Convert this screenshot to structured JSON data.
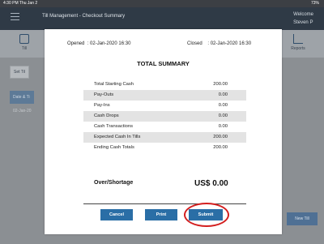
{
  "status_bar": {
    "time": "4:30 PM   Thu Jan 2",
    "battery": "73%"
  },
  "app_header": {
    "welcome_line1": "Welcome",
    "welcome_line2": "Steven P"
  },
  "background": {
    "tabs": [
      {
        "label": "Till"
      },
      {
        "label": "Reports"
      }
    ],
    "set_button": "Set Til",
    "panel_label": "Date & Ti",
    "row_text": "02-Jan-20",
    "right_button": "New Till"
  },
  "modal": {
    "title": "Till Management - Checkout Summary",
    "opened_label": "Opened",
    "opened_value": ": 02-Jan-2020 16:30",
    "closed_label": "Closed",
    "closed_value": ": 02-Jan-2020 16:30",
    "summary_title": "TOTAL SUMMARY",
    "rows": [
      {
        "label": "Total Starting Cash",
        "value": "200.00"
      },
      {
        "label": "Pay-Outs",
        "value": "0.00"
      },
      {
        "label": "Pay-Ins",
        "value": "0.00"
      },
      {
        "label": "Cash Drops",
        "value": "0.00"
      },
      {
        "label": "Cash Transactions",
        "value": "0.00"
      },
      {
        "label": "Expected Cash In Tills",
        "value": "200.00"
      },
      {
        "label": "Ending Cash Totals",
        "value": "200.00"
      }
    ],
    "over_shortage_label": "Over/Shortage",
    "over_shortage_value": "US$ 0.00",
    "buttons": {
      "cancel": "Cancel",
      "print": "Print",
      "submit": "Submit"
    }
  },
  "colors": {
    "primary_button": "#2a6ea6",
    "highlight_ring": "#d31f1f",
    "shaded_row": "#e3e3e3"
  }
}
